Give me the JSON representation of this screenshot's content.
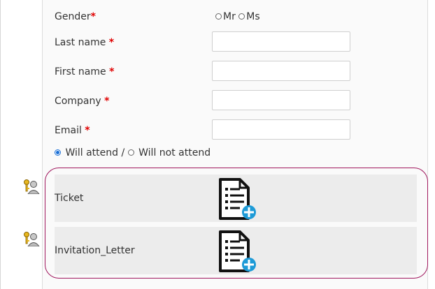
{
  "form": {
    "gender_label": "Gender",
    "gender_options": [
      "Mr",
      "Ms"
    ],
    "required_marker": "*",
    "last_name_label": "Last name",
    "first_name_label": "First name",
    "company_label": "Company",
    "email_label": "Email",
    "last_name_value": "",
    "first_name_value": "",
    "company_value": "",
    "email_value": ""
  },
  "attendance": {
    "will_attend": "Will attend",
    "separator": "/",
    "will_not_attend": "Will not attend",
    "selected": "Will attend"
  },
  "documents": [
    {
      "label": "Ticket",
      "icon": "document-add-icon"
    },
    {
      "label": "Invitation_Letter",
      "icon": "document-add-icon"
    }
  ],
  "colors": {
    "required": "#e00000",
    "frame": "#a0185e",
    "add_badge": "#1e9bd7"
  }
}
